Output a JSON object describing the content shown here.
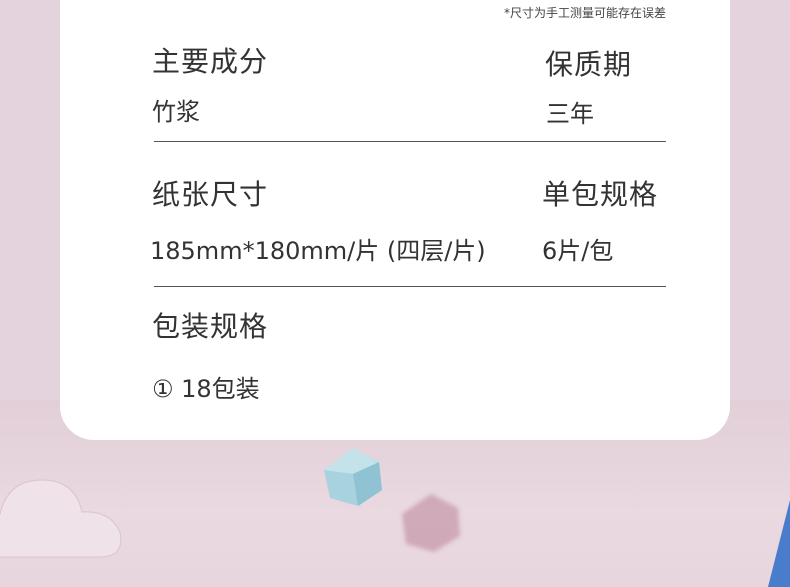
{
  "note": "*尺寸为手工测量可能存在误差",
  "specs": {
    "ingredient": {
      "label": "主要成分",
      "value": "竹浆"
    },
    "shelf_life": {
      "label": "保质期",
      "value": "三年"
    },
    "paper_size": {
      "label": "纸张尺寸",
      "value": "185mm*180mm/片 (四层/片)"
    },
    "pack_spec": {
      "label": "单包规格",
      "value": "6片/包"
    },
    "packaging": {
      "label": "包装规格",
      "value": "① 18包装"
    }
  },
  "decor": {
    "cloud_color": "#efe2e8",
    "gem_blue_color": "#a9d3df",
    "gem_pink_color": "#c99aac",
    "edge_blue_color": "#4a7ccc"
  }
}
